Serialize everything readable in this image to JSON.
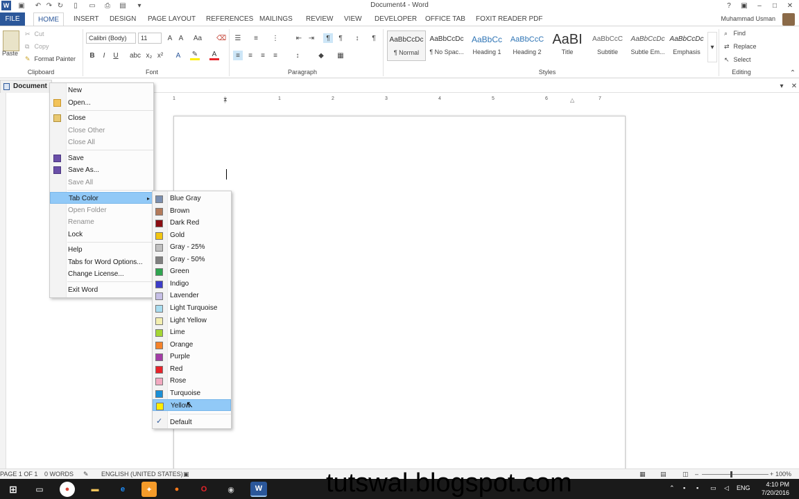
{
  "window": {
    "title": "Document4 - Word"
  },
  "tabs": {
    "file": "FILE",
    "items": [
      "HOME",
      "INSERT",
      "DESIGN",
      "PAGE LAYOUT",
      "REFERENCES",
      "MAILINGS",
      "REVIEW",
      "VIEW",
      "DEVELOPER",
      "OFFICE TAB",
      "FOXIT READER PDF"
    ],
    "active": "HOME",
    "user": "Muhammad Usman"
  },
  "clipboard": {
    "paste": "Paste",
    "cut": "Cut",
    "copy": "Copy",
    "format_painter": "Format Painter",
    "label": "Clipboard"
  },
  "font": {
    "name": "Calibri (Body)",
    "size": "11",
    "label": "Font"
  },
  "paragraph": {
    "label": "Paragraph"
  },
  "styles": {
    "label": "Styles",
    "items": [
      {
        "preview": "AaBbCcDc",
        "name": "¶ Normal"
      },
      {
        "preview": "AaBbCcDc",
        "name": "¶ No Spac..."
      },
      {
        "preview": "AaBbCc",
        "name": "Heading 1"
      },
      {
        "preview": "AaBbCcC",
        "name": "Heading 2"
      },
      {
        "preview": "AaBI",
        "name": "Title"
      },
      {
        "preview": "AaBbCcC",
        "name": "Subtitle"
      },
      {
        "preview": "AaBbCcDc",
        "name": "Subtle Em..."
      },
      {
        "preview": "AaBbCcDc",
        "name": "Emphasis"
      }
    ]
  },
  "editing": {
    "find": "Find",
    "replace": "Replace",
    "select": "Select",
    "label": "Editing"
  },
  "doc_tab": {
    "label": "Document"
  },
  "ruler": {
    "numbers": [
      "1",
      "1",
      "2",
      "3",
      "4",
      "5",
      "6",
      "7"
    ]
  },
  "context_menu": {
    "items": [
      {
        "label": "New",
        "enabled": true
      },
      {
        "label": "Open...",
        "enabled": true
      },
      {
        "label": "Close",
        "enabled": true
      },
      {
        "label": "Close Other",
        "enabled": false
      },
      {
        "label": "Close All",
        "enabled": false
      },
      {
        "label": "Save",
        "enabled": true
      },
      {
        "label": "Save As...",
        "enabled": true
      },
      {
        "label": "Save All",
        "enabled": false
      },
      {
        "label": "Tab Color",
        "enabled": true
      },
      {
        "label": "Open Folder",
        "enabled": false
      },
      {
        "label": "Rename",
        "enabled": false
      },
      {
        "label": "Lock",
        "enabled": true
      },
      {
        "label": "Help",
        "enabled": true
      },
      {
        "label": "Tabs for Word Options...",
        "enabled": true
      },
      {
        "label": "Change License...",
        "enabled": true
      },
      {
        "label": "Exit Word",
        "enabled": true
      }
    ]
  },
  "tab_colors": {
    "items": [
      {
        "label": "Blue Gray",
        "color": "#7b8fb0"
      },
      {
        "label": "Brown",
        "color": "#b37a5a"
      },
      {
        "label": "Dark Red",
        "color": "#8b0d12"
      },
      {
        "label": "Gold",
        "color": "#f2c511"
      },
      {
        "label": "Gray - 25%",
        "color": "#c0c0c0"
      },
      {
        "label": "Gray - 50%",
        "color": "#808080"
      },
      {
        "label": "Green",
        "color": "#2ea44f"
      },
      {
        "label": "Indigo",
        "color": "#3c3cc8"
      },
      {
        "label": "Lavender",
        "color": "#c6bfe6"
      },
      {
        "label": "Light Turquoise",
        "color": "#a8dcf0"
      },
      {
        "label": "Light Yellow",
        "color": "#f3efb0"
      },
      {
        "label": "Lime",
        "color": "#a4d633"
      },
      {
        "label": "Orange",
        "color": "#f5822a"
      },
      {
        "label": "Purple",
        "color": "#a33ca6"
      },
      {
        "label": "Red",
        "color": "#e8232a"
      },
      {
        "label": "Rose",
        "color": "#f2a9c0"
      },
      {
        "label": "Turquoise",
        "color": "#1a8fd6"
      },
      {
        "label": "Yellow",
        "color": "#ffee00"
      }
    ],
    "highlighted": "Yellow",
    "default": "Default"
  },
  "status": {
    "page": "PAGE 1 OF 1",
    "words": "0 WORDS",
    "language": "ENGLISH (UNITED STATES)",
    "zoom": "100%"
  },
  "taskbar": {
    "lang": "ENG",
    "time": "4:10 PM",
    "date": "7/20/2016"
  },
  "watermark": "tutswal.blogspot.com"
}
